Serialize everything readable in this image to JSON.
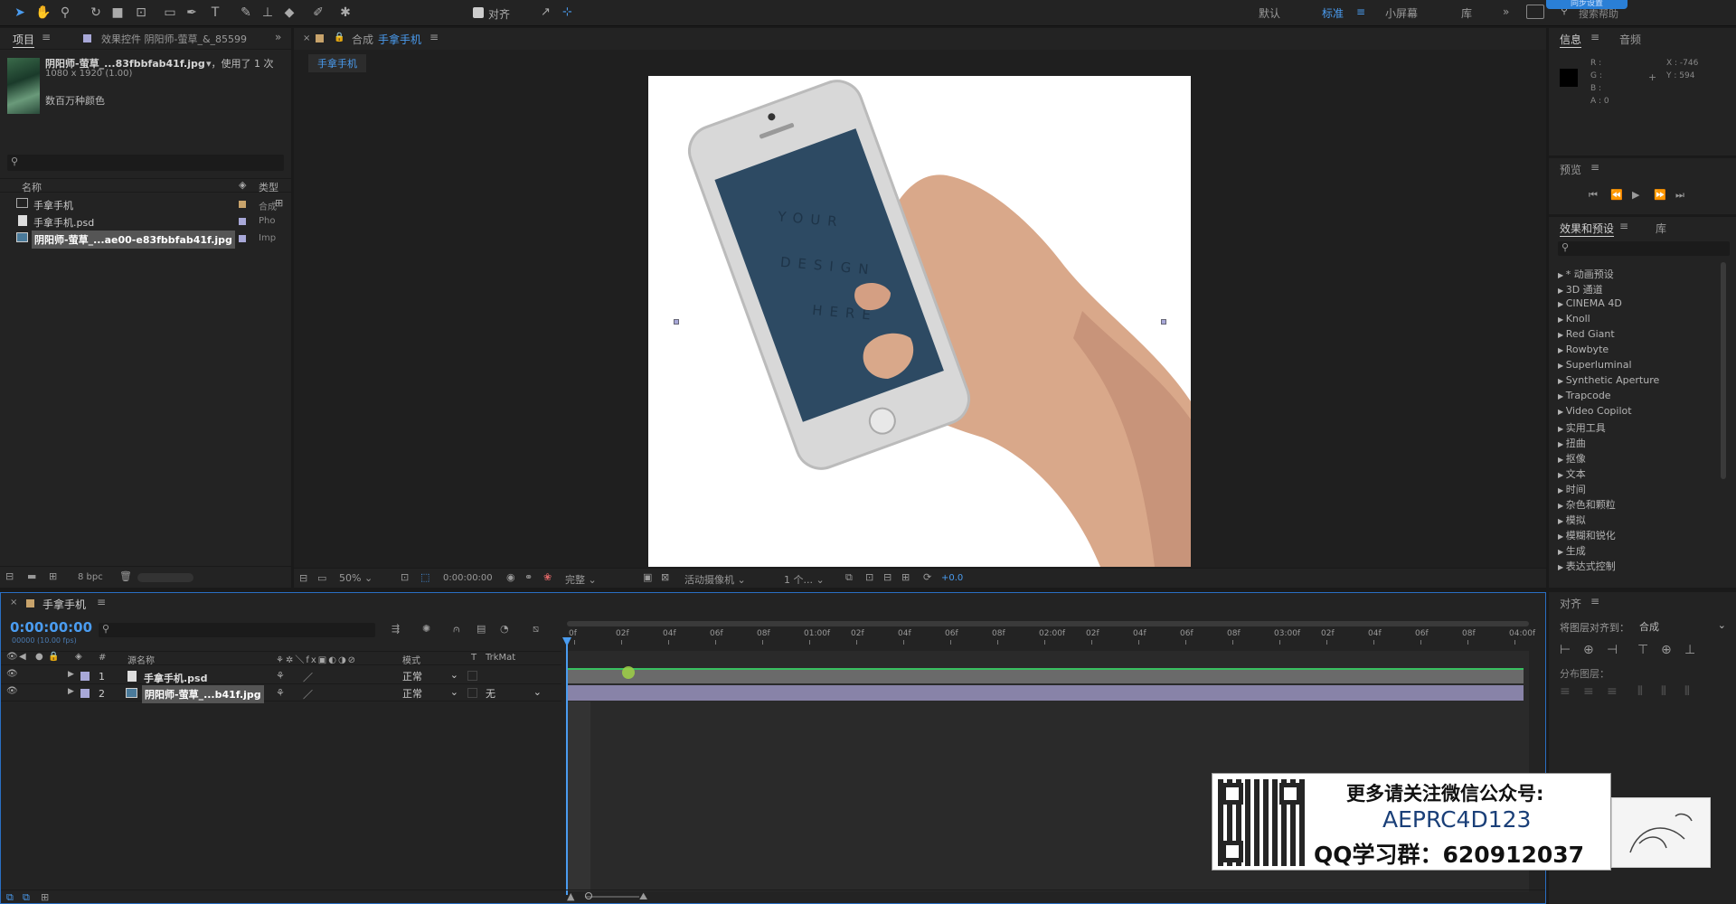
{
  "toolbar": {
    "align_label": "对齐",
    "workspaces": [
      "默认",
      "标准",
      "小屏幕",
      "库"
    ],
    "active_workspace": "标准",
    "search_help_placeholder": "搜索帮助",
    "sync_label": "同步设置"
  },
  "project_panel": {
    "tab_label": "项目",
    "effects_tab_label": "效果控件 阴阳师-萤草_&_85599",
    "item_name": "阴阳师-萤草_...83fbbfab41f.jpg",
    "usage": "▾，使用了 1 次",
    "dimensions": "1080 x 1920 (1.00)",
    "color_depth": "数百万种颜色",
    "search_placeholder": "",
    "col_name": "名称",
    "col_type": "类型",
    "items": [
      {
        "name": "手拿手机",
        "type": "合成",
        "color": "#c8a36b"
      },
      {
        "name": "手拿手机.psd",
        "type": "Pho",
        "color": "#a8a8d8"
      },
      {
        "name": "阴阳师-萤草_...ae00-e83fbbfab41f.jpg",
        "type": "Imp",
        "color": "#a8a8d8"
      }
    ],
    "bpc": "8 bpc"
  },
  "composition_panel": {
    "tab_prefix": "合成",
    "tab_name": "手拿手机",
    "subtab": "手拿手机",
    "phone_screen_text": [
      "YOUR",
      "DESIGN",
      "HERE"
    ],
    "zoom": "50%",
    "timecode": "0:00:00:00",
    "resolution": "完整",
    "camera": "活动摄像机",
    "views": "1 个...",
    "exposure": "+0.0"
  },
  "info_panel": {
    "tab": "信息",
    "audio_tab": "音频",
    "r": "R :",
    "g": "G :",
    "b": "B :",
    "a": "A : 0",
    "x": "X : -746",
    "y": "Y : 594"
  },
  "preview_panel": {
    "tab": "预览"
  },
  "effects_panel": {
    "tab": "效果和预设",
    "lib_tab": "库",
    "search_placeholder": "",
    "items": [
      "* 动画预设",
      "3D 通道",
      "CINEMA 4D",
      "Knoll",
      "Red Giant",
      "Rowbyte",
      "Superluminal",
      "Synthetic Aperture",
      "Trapcode",
      "Video Copilot",
      "实用工具",
      "扭曲",
      "抠像",
      "文本",
      "时间",
      "杂色和颗粒",
      "模拟",
      "模糊和锐化",
      "生成",
      "表达式控制"
    ]
  },
  "align_panel": {
    "tab": "对齐",
    "align_to_label": "将图层对齐到：",
    "align_to_value": "合成",
    "distribute_label": "分布图层："
  },
  "timeline": {
    "tab": "手拿手机",
    "timecode": "0:00:00:00",
    "fps": "00000 (10.00 fps)",
    "search_placeholder": "",
    "col_num": "#",
    "col_source": "源名称",
    "col_mode": "模式",
    "col_t": "T",
    "col_trkmat": "TrkMat",
    "ruler": [
      "0f",
      "02f",
      "04f",
      "06f",
      "08f",
      "01:00f",
      "02f",
      "04f",
      "06f",
      "08f",
      "02:00f",
      "02f",
      "04f",
      "06f",
      "08f",
      "03:00f",
      "02f",
      "04f",
      "06f",
      "08f",
      "04:00f"
    ],
    "layers": [
      {
        "num": "1",
        "name": "手拿手机.psd",
        "mode": "正常",
        "trkmat": ""
      },
      {
        "num": "2",
        "name": "阴阳师-萤草_...b41f.jpg",
        "mode": "正常",
        "trkmat": "无"
      }
    ]
  },
  "watermark": {
    "line1": "更多请关注微信公众号:",
    "line2": "AEPRC4D123",
    "line3": "QQ学习群：620912037"
  }
}
